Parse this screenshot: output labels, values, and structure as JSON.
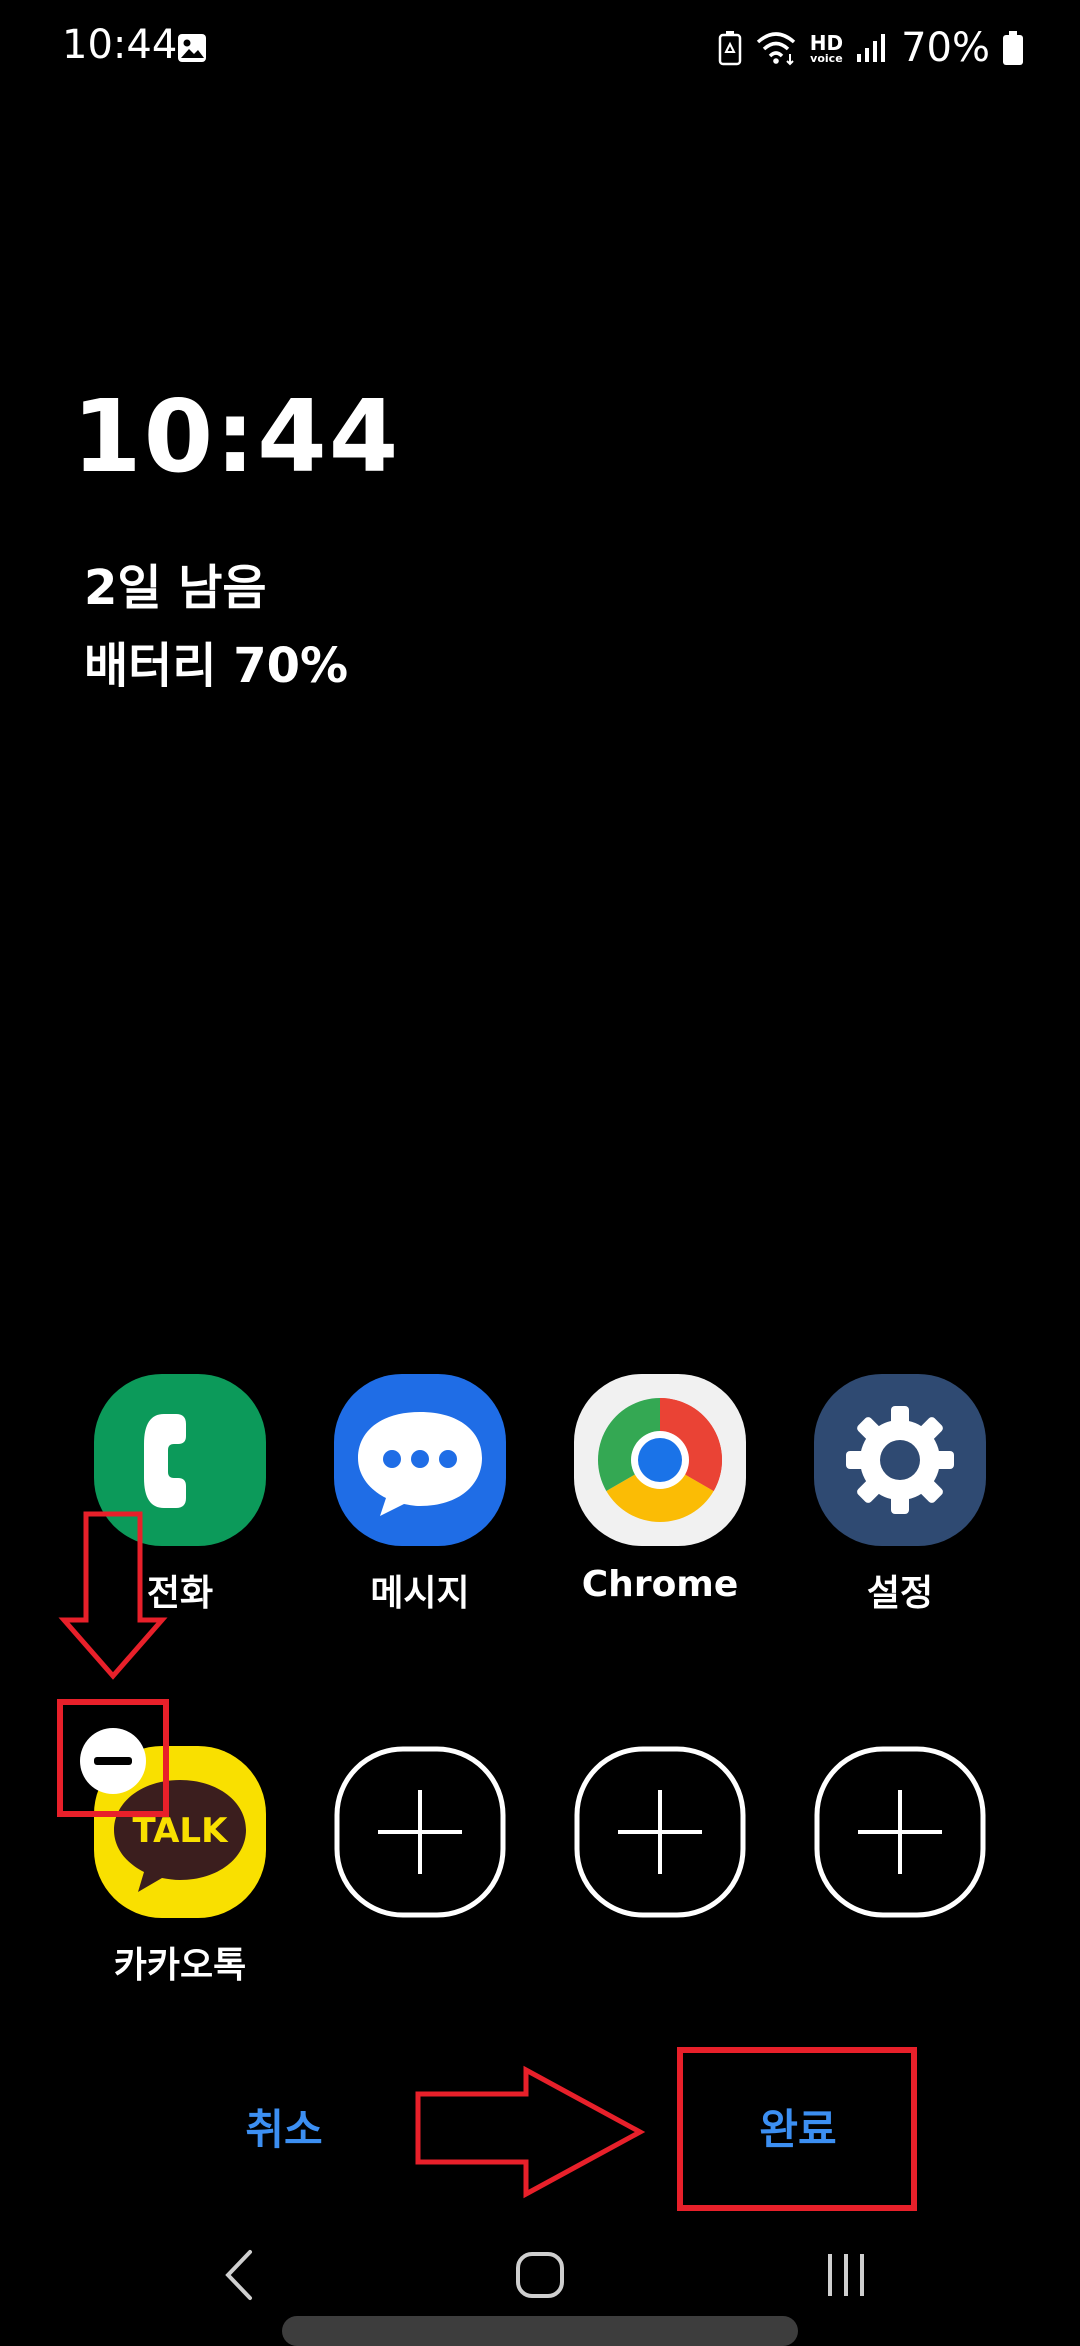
{
  "status_bar": {
    "time": "10:44",
    "battery_percent": "70%",
    "icons": [
      "gallery-icon",
      "battery-saver-icon",
      "wifi-icon",
      "hd-voice-icon",
      "signal-icon",
      "battery-icon"
    ],
    "hd_voice_top": "HD",
    "hd_voice_bottom": "voice"
  },
  "lock_screen": {
    "clock": "10:44",
    "battery_remaining": "2일 남음",
    "battery_level": "배터리 70%"
  },
  "apps": {
    "row1": [
      {
        "label": "전화",
        "icon": "phone-icon",
        "color": "#0c9a5a"
      },
      {
        "label": "메시지",
        "icon": "message-icon",
        "color": "#1f6de6"
      },
      {
        "label": "Chrome",
        "icon": "chrome-icon",
        "color": "#f1f1f1"
      },
      {
        "label": "설정",
        "icon": "settings-icon",
        "color": "#2f4a72"
      }
    ],
    "row2": [
      {
        "label": "카카오톡",
        "icon": "kakaotalk-icon",
        "color": "#f9e000",
        "icon_text": "TALK"
      }
    ],
    "empty_slot_count": 3
  },
  "buttons": {
    "cancel": "취소",
    "done": "완료"
  },
  "colors": {
    "accent": "#3c8ff2",
    "annotation": "#e8202a",
    "background": "#000000"
  }
}
